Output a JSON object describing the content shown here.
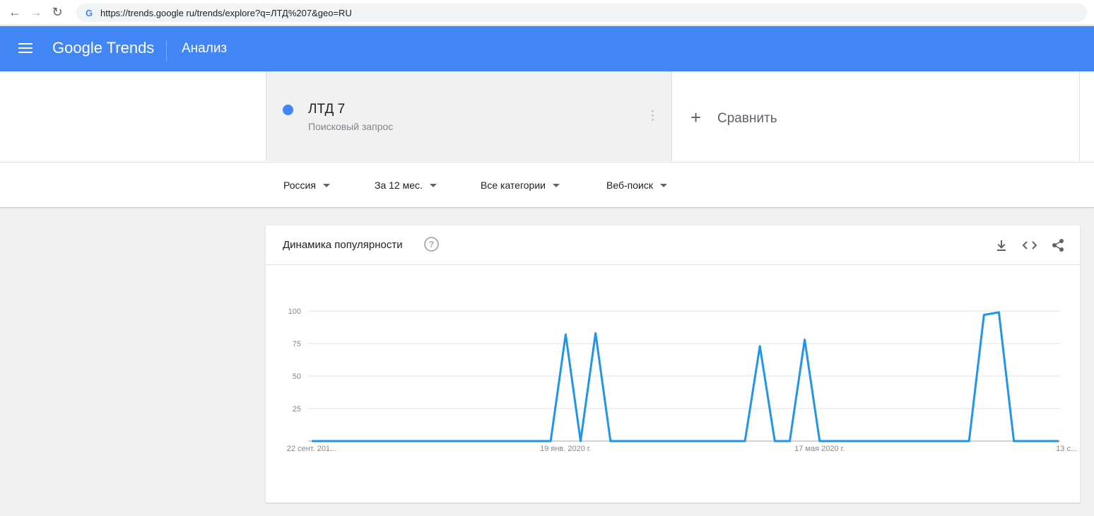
{
  "browser": {
    "url": "https://trends.google ru/trends/explore?q=ЛТД%207&geo=RU",
    "favicon_letter": "G"
  },
  "header": {
    "logo": "Google Trends",
    "title": "Анализ"
  },
  "term": {
    "name": "ЛТД 7",
    "type": "Поисковый запрос",
    "color": "#4285f4"
  },
  "compare": {
    "label": "Сравнить"
  },
  "filters": {
    "region": "Россия",
    "period": "За 12 мес.",
    "category": "Все категории",
    "search_type": "Веб-поиск"
  },
  "chart_card": {
    "title": "Динамика популярности",
    "help": "?"
  },
  "chart_data": {
    "type": "line",
    "series": [
      {
        "color": "#2196e8",
        "values": [
          0,
          0,
          0,
          0,
          0,
          0,
          0,
          0,
          0,
          0,
          0,
          0,
          0,
          0,
          0,
          0,
          0,
          82,
          0,
          83,
          0,
          0,
          0,
          0,
          0,
          0,
          0,
          0,
          0,
          0,
          73,
          0,
          0,
          78,
          0,
          0,
          0,
          0,
          0,
          0,
          0,
          0,
          0,
          0,
          0,
          97,
          99,
          0,
          0,
          0,
          0
        ]
      }
    ],
    "x_labels": [
      {
        "index": 0,
        "text": "22 сент. 201..."
      },
      {
        "index": 17,
        "text": "19 янв. 2020 г."
      },
      {
        "index": 34,
        "text": "17 мая 2020 г."
      },
      {
        "index": 51,
        "text": "13 с..."
      }
    ],
    "y_ticks": [
      25,
      50,
      75,
      100
    ],
    "ylim": [
      0,
      100
    ],
    "grid": true
  }
}
